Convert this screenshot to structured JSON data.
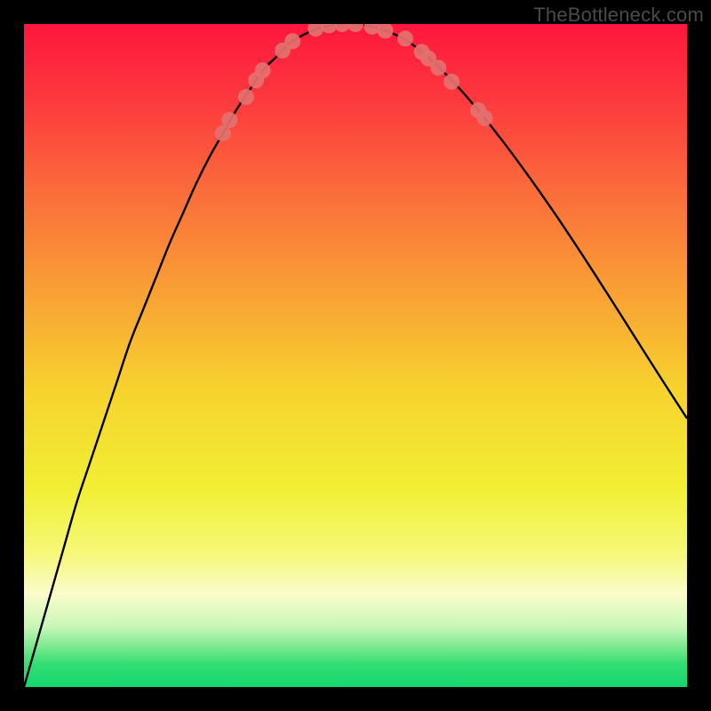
{
  "watermark": "TheBottleneck.com",
  "chart_data": {
    "type": "line",
    "title": "",
    "xlabel": "",
    "ylabel": "",
    "xlim": [
      0,
      100
    ],
    "ylim": [
      0,
      100
    ],
    "legend": false,
    "grid": false,
    "background": {
      "type": "vertical-gradient",
      "stops": [
        {
          "pos": 0.0,
          "color": "#fe163d"
        },
        {
          "pos": 0.12,
          "color": "#fd3b3e"
        },
        {
          "pos": 0.25,
          "color": "#fb6b3b"
        },
        {
          "pos": 0.4,
          "color": "#f99f35"
        },
        {
          "pos": 0.55,
          "color": "#f7d22e"
        },
        {
          "pos": 0.7,
          "color": "#f1ef33"
        },
        {
          "pos": 0.8,
          "color": "#f6f87a"
        },
        {
          "pos": 0.86,
          "color": "#fbfccc"
        },
        {
          "pos": 0.91,
          "color": "#c7f6b7"
        },
        {
          "pos": 0.94,
          "color": "#7ae98e"
        },
        {
          "pos": 0.965,
          "color": "#34dd74"
        },
        {
          "pos": 1.0,
          "color": "#12d86e"
        }
      ]
    },
    "series": [
      {
        "name": "bottleneck-curve",
        "color": "#000000",
        "x": [
          0,
          2,
          4,
          6,
          8,
          10,
          12,
          14,
          16,
          18,
          20,
          22,
          24,
          26,
          28,
          30,
          32,
          34,
          36,
          38,
          40,
          42,
          44,
          46,
          48,
          50,
          52,
          54,
          56,
          58,
          60,
          62,
          65,
          68,
          72,
          76,
          80,
          84,
          88,
          92,
          96,
          100
        ],
        "y": [
          0,
          7,
          14,
          21,
          28,
          34,
          40,
          46,
          52,
          57,
          62,
          67,
          71.5,
          76,
          80,
          83.5,
          87,
          90,
          93,
          95,
          97,
          98.3,
          99.2,
          99.7,
          100,
          100,
          99.7,
          99.2,
          98.4,
          97.3,
          95.8,
          94,
          91,
          87.6,
          82.6,
          77.2,
          71.5,
          65.5,
          59.3,
          53,
          46.7,
          40.5
        ]
      }
    ],
    "markers": {
      "name": "highlight-dots",
      "color": "#e4716e",
      "radius": 9,
      "points": [
        {
          "x": 30.0,
          "y": 83.5
        },
        {
          "x": 31.0,
          "y": 85.5
        },
        {
          "x": 33.5,
          "y": 89.0
        },
        {
          "x": 35.0,
          "y": 91.5
        },
        {
          "x": 36.0,
          "y": 93.0
        },
        {
          "x": 39.0,
          "y": 96.0
        },
        {
          "x": 40.5,
          "y": 97.4
        },
        {
          "x": 44.0,
          "y": 99.3
        },
        {
          "x": 46.0,
          "y": 99.8
        },
        {
          "x": 48.0,
          "y": 100.0
        },
        {
          "x": 50.0,
          "y": 100.0
        },
        {
          "x": 52.5,
          "y": 99.6
        },
        {
          "x": 54.5,
          "y": 99.0
        },
        {
          "x": 57.5,
          "y": 97.8
        },
        {
          "x": 60.0,
          "y": 95.8
        },
        {
          "x": 61.0,
          "y": 94.8
        },
        {
          "x": 62.5,
          "y": 93.4
        },
        {
          "x": 64.5,
          "y": 91.3
        },
        {
          "x": 68.5,
          "y": 87.0
        },
        {
          "x": 69.5,
          "y": 85.8
        }
      ]
    }
  }
}
